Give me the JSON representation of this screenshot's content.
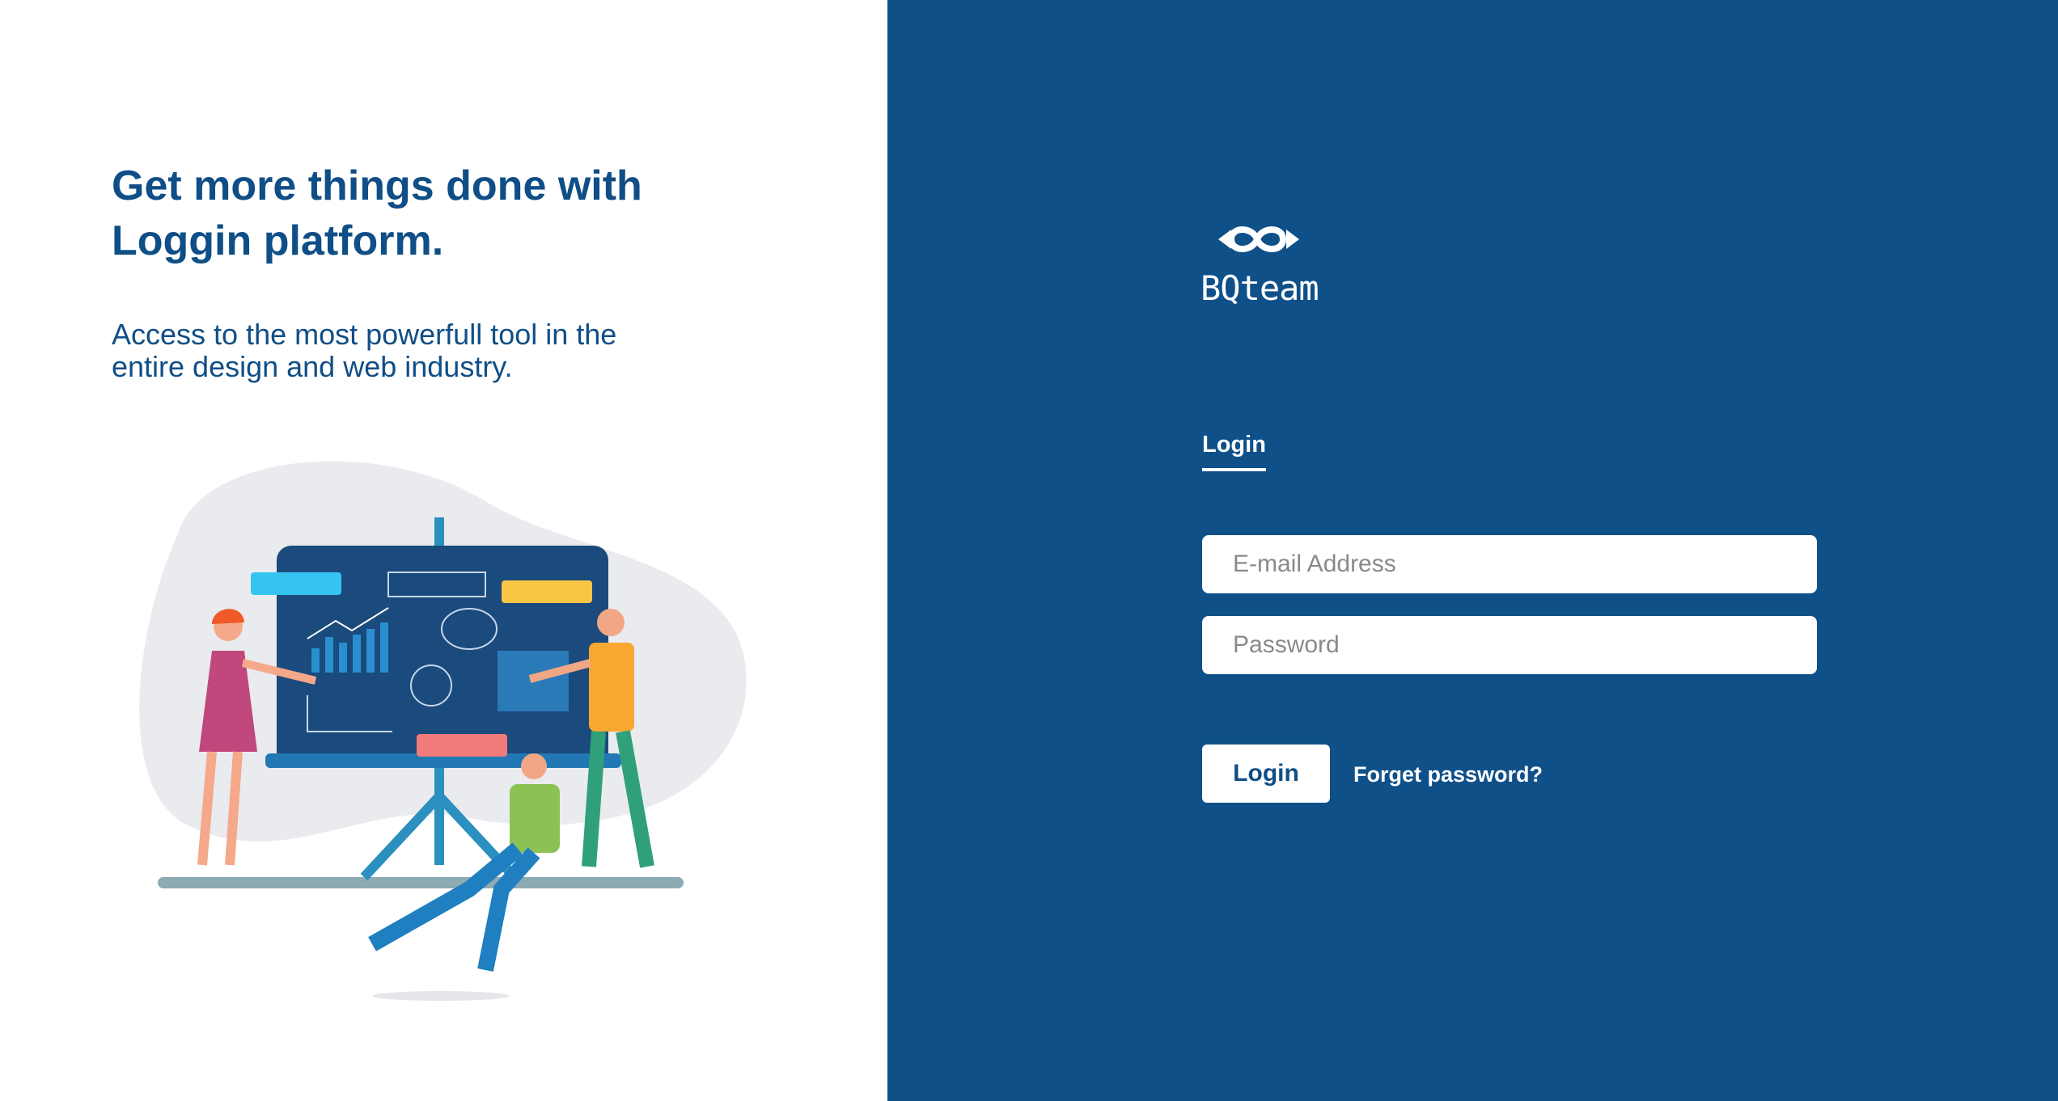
{
  "hero": {
    "headline_line1": "Get more things done with",
    "headline_line2": "Loggin platform.",
    "subline_line1": "Access to the most powerfull tool in the",
    "subline_line2": "entire design and web industry."
  },
  "brand": {
    "logo_icon": "linked-rings-logo-icon",
    "name": "BQteam"
  },
  "form": {
    "tab_label": "Login",
    "email_placeholder": "E-mail Address",
    "email_value": "",
    "password_placeholder": "Password",
    "password_value": "",
    "submit_label": "Login",
    "forgot_label": "Forget password?"
  },
  "colors": {
    "brand_blue": "#0f5089",
    "heading_blue": "#0f4e86",
    "white": "#ffffff"
  }
}
